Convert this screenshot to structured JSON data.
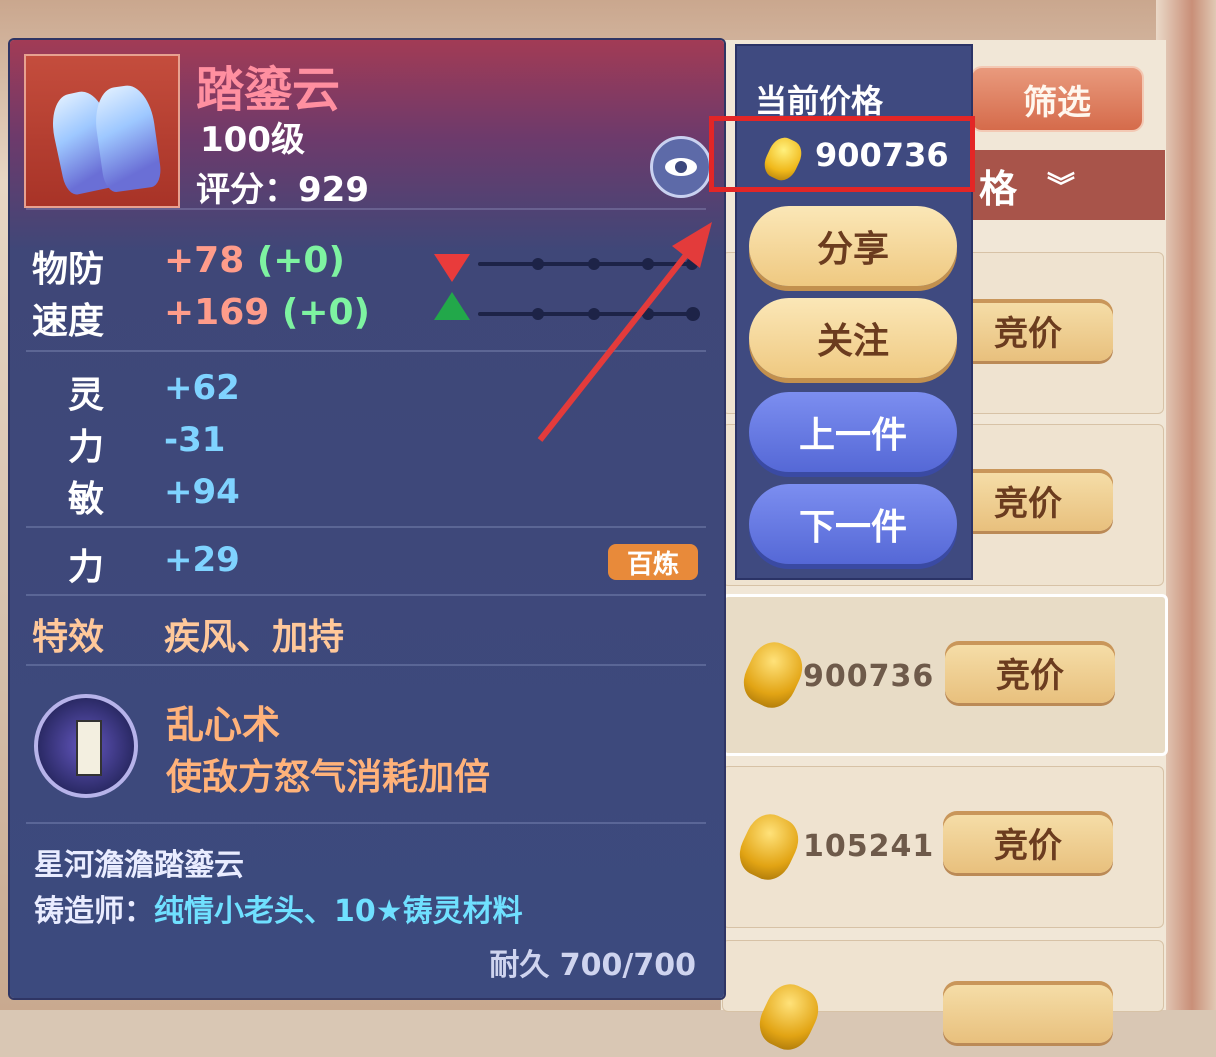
{
  "item": {
    "name": "踏鎏云",
    "level": "100级",
    "score_label": "评分：929"
  },
  "base_stats": [
    {
      "label": "物防",
      "value": "+78",
      "delta": "(+0)",
      "trend": "down"
    },
    {
      "label": "速度",
      "value": "+169",
      "delta": "(+0)",
      "trend": "up"
    }
  ],
  "attributes": [
    {
      "label": "灵",
      "value": "+62"
    },
    {
      "label": "力",
      "value": "-31"
    },
    {
      "label": "敏",
      "value": "+94"
    }
  ],
  "refine": {
    "label": "力",
    "value": "+29",
    "badge": "百炼"
  },
  "special_effect": {
    "label": "特效",
    "value": "疾风、加持"
  },
  "skill": {
    "name": "乱心术",
    "desc": "使敌方怒气消耗加倍",
    "icon": "skill-talisman-icon"
  },
  "footer": {
    "set_name": "星河澹澹踏鎏云",
    "crafter_label": "铸造师：",
    "crafter_value": "纯情小老头、10★铸灵材料",
    "durability": "耐久 700/700"
  },
  "popup": {
    "title": "当前价格",
    "price": "900736",
    "buttons": {
      "share": "分享",
      "follow": "关注",
      "prev": "上一件",
      "next": "下一件"
    }
  },
  "market": {
    "filter_label": "筛选",
    "sort_label": "格",
    "bid_label": "竞价",
    "rows": [
      {
        "price": ""
      },
      {
        "price": ""
      },
      {
        "price": "900736"
      },
      {
        "price": "105241"
      }
    ]
  },
  "colors": {
    "highlight_box": "#e32626",
    "panel_bg": "#3c4a7e",
    "name_color": "#ff8fa0"
  }
}
